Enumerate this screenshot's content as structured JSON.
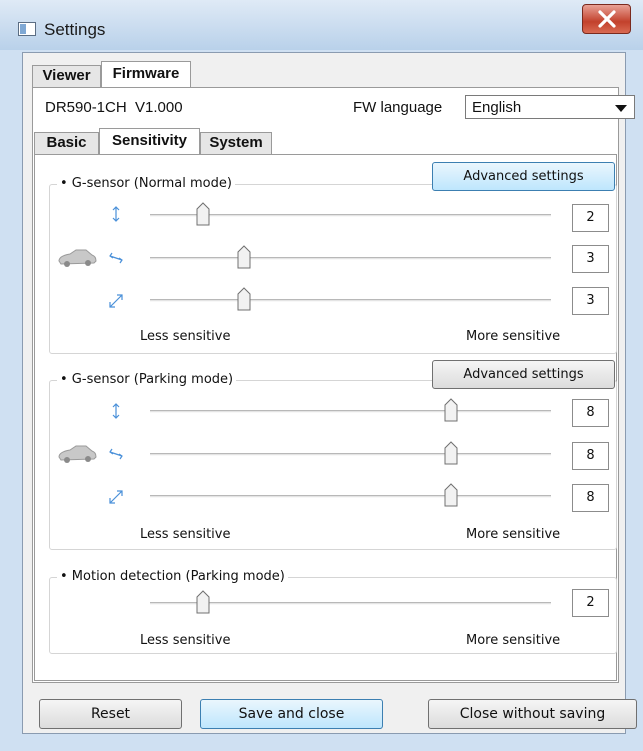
{
  "window": {
    "title": "Settings"
  },
  "outer_tabs": [
    {
      "label": "Viewer",
      "active": false
    },
    {
      "label": "Firmware",
      "active": true
    }
  ],
  "firmware": {
    "model": "DR590-1CH",
    "version": "V1.000",
    "language_label": "FW language",
    "language_value": "English"
  },
  "inner_tabs": [
    {
      "label": "Basic",
      "active": false
    },
    {
      "label": "Sensitivity",
      "active": true
    },
    {
      "label": "System",
      "active": false
    }
  ],
  "scale": {
    "less": "Less sensitive",
    "more": "More sensitive",
    "min": 1,
    "max": 10
  },
  "normal": {
    "label": "• G-sensor (Normal mode)",
    "advanced_label": "Advanced settings",
    "axes": [
      {
        "icon": "vertical-arrow-icon",
        "value": "2"
      },
      {
        "icon": "horizontal-arrow-icon",
        "value": "3"
      },
      {
        "icon": "diagonal-arrow-icon",
        "value": "3"
      }
    ]
  },
  "parking": {
    "label": "• G-sensor (Parking mode)",
    "advanced_label": "Advanced settings",
    "axes": [
      {
        "icon": "vertical-arrow-icon",
        "value": "8"
      },
      {
        "icon": "horizontal-arrow-icon",
        "value": "8"
      },
      {
        "icon": "diagonal-arrow-icon",
        "value": "8"
      }
    ]
  },
  "motion": {
    "label": "• Motion detection (Parking mode)",
    "value": "2"
  },
  "buttons": {
    "reset": "Reset",
    "save": "Save and close",
    "close": "Close without saving"
  },
  "colors": {
    "accent": "#3c7fb1",
    "close": "#c2412c",
    "icon_arrow": "#4a90d9"
  }
}
